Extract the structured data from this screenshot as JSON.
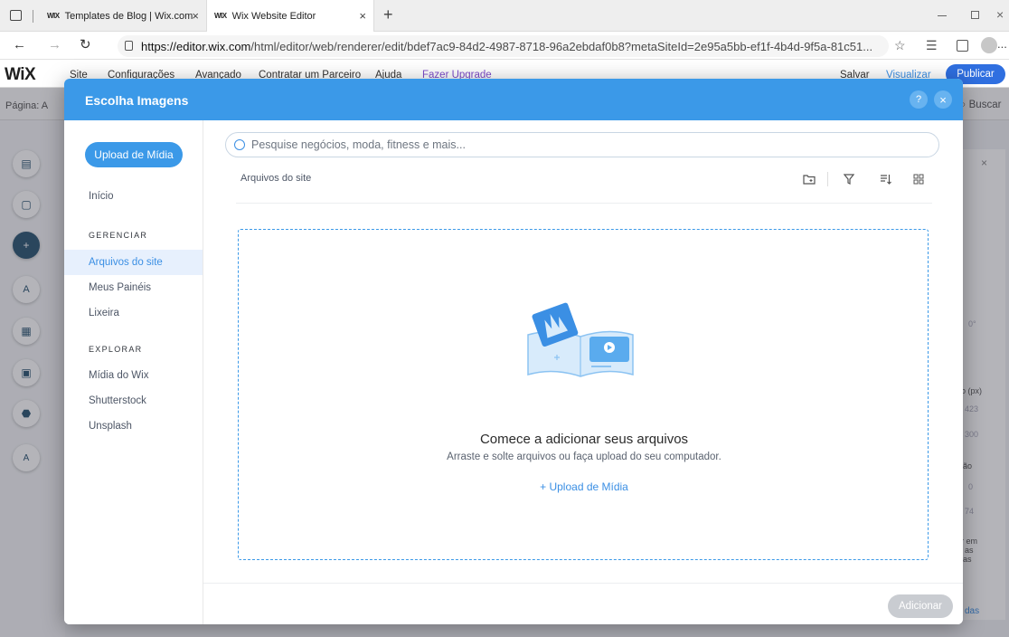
{
  "browser": {
    "tabs": [
      {
        "favicon": "WIX",
        "title": "Templates de Blog | Wix.com",
        "close": "×"
      },
      {
        "favicon": "WIX",
        "title": "Wix Website Editor",
        "close": "×"
      }
    ],
    "new_tab": "+",
    "url_domain": "https://editor.wix.com",
    "url_path": "/html/editor/web/renderer/edit/bdef7ac9-84d2-4987-8718-96a2ebdaf0b8?metaSiteId=2e95a5bb-ef1f-4b4d-9f5a-81c51...",
    "more": "..."
  },
  "wix_topbar": {
    "logo": "WiX",
    "menu": [
      "Site",
      "Configurações",
      "Avançado",
      "Contratar um Parceiro",
      "Ajuda",
      "Fazer Upgrade"
    ],
    "save": "Salvar",
    "preview": "Visualizar",
    "publish": "Publicar"
  },
  "editor": {
    "page_label": "Página: A",
    "search": "Buscar",
    "right_panel": {
      "unit": "o (px)",
      "val1": "423",
      "val2": "300",
      "val3": "ão",
      "val4": "0",
      "val5": "74",
      "text1": "r em",
      "text2": "as",
      "text3": "ias",
      "bottom": "das",
      "angle": "0°"
    }
  },
  "modal": {
    "title": "Escolha Imagens",
    "help": "?",
    "close": "×",
    "upload_button": "Upload de Mídia",
    "sidebar": {
      "home": "Início",
      "manage_header": "GERENCIAR",
      "manage_items": [
        "Arquivos do site",
        "Meus Painéis",
        "Lixeira"
      ],
      "explore_header": "EXPLORAR",
      "explore_items": [
        "Mídia do Wix",
        "Shutterstock",
        "Unsplash"
      ]
    },
    "search_placeholder": "Pesquise negócios, moda, fitness e mais...",
    "breadcrumb": "Arquivos do site",
    "empty_title": "Comece a adicionar seus arquivos",
    "empty_subtitle": "Arraste e solte arquivos ou faça upload do seu computador.",
    "upload_link": "+ Upload de Mídia",
    "add_button": "Adicionar"
  },
  "colors": {
    "accent": "#3b99e8",
    "publish": "#2f6fe0",
    "upgrade": "#7d4cc9",
    "disabled": "#c9ccd1"
  }
}
